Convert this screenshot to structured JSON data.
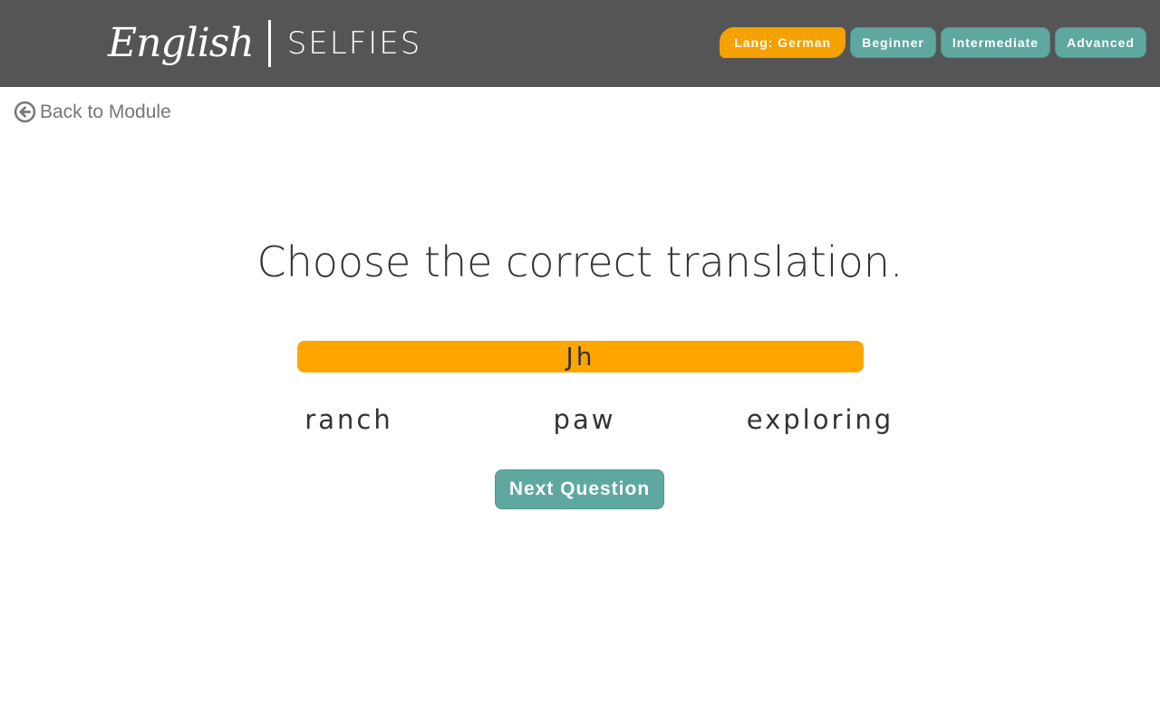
{
  "header": {
    "logo_script": "English",
    "logo_brand": "SELFIES",
    "nav": {
      "lang": "Lang: German",
      "beginner": "Beginner",
      "intermediate": "Intermediate",
      "advanced": "Advanced"
    }
  },
  "back": {
    "label": "Back to Module",
    "icon": "arrow-left-circle-icon"
  },
  "quiz": {
    "prompt": "Choose the correct translation.",
    "word": "Jh",
    "options": [
      "ranch",
      "paw",
      "exploring"
    ],
    "next_label": "Next Question"
  },
  "colors": {
    "header_bg": "#555555",
    "accent_orange": "#f5a100",
    "accent_teal": "#5fa8a0",
    "text_dark": "#333333",
    "text_muted": "#777777"
  }
}
